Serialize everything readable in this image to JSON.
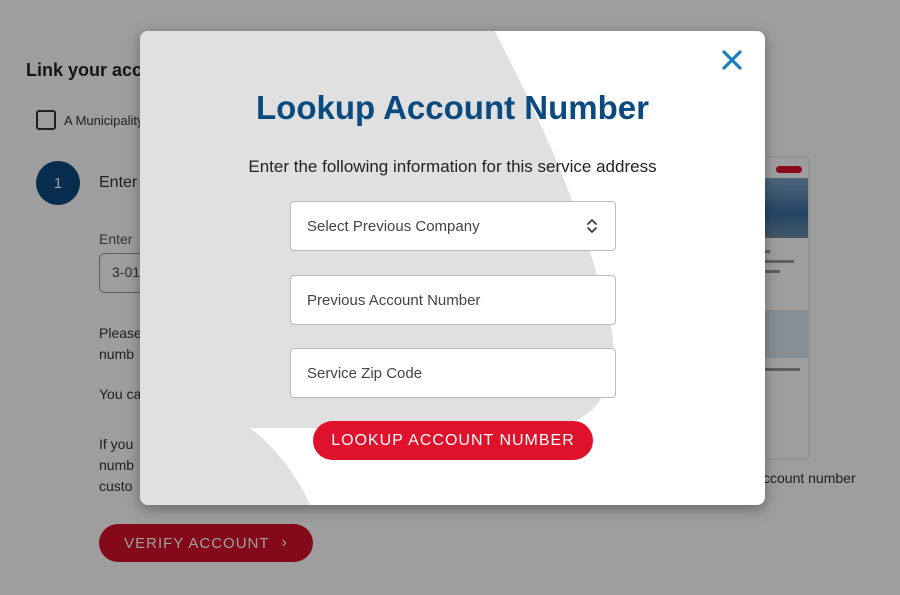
{
  "background": {
    "title": "Link your acc",
    "checkbox_label": "A Municipality",
    "step_number": "1",
    "step_text": "Enter",
    "input_label": "Enter",
    "input_value": "3-01",
    "para1_line1": "Please",
    "para1_line2": "numb",
    "para2": "You ca",
    "para3_line1": "If you",
    "para3_line2": "numb",
    "para3_line3": "custo",
    "preview_caption": "ccount number",
    "verify_label": "VERIFY ACCOUNT",
    "verify_chevron": "›"
  },
  "modal": {
    "title": "Lookup Account Number",
    "subtitle": "Enter the following information for this service address",
    "select_company": "Select Previous Company",
    "account_placeholder": "Previous Account Number",
    "zip_placeholder": "Service Zip Code",
    "lookup_label": "LOOKUP ACCOUNT NUMBER"
  },
  "colors": {
    "brand_blue": "#0b4a7f",
    "accent_red": "#e0112b",
    "close_blue": "#1a7fc1"
  }
}
